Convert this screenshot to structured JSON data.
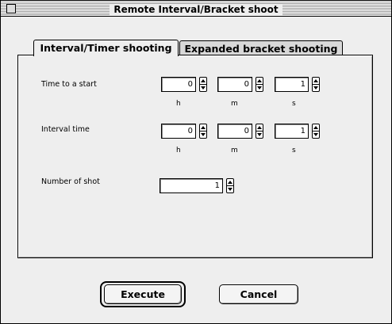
{
  "window": {
    "title": "Remote Interval/Bracket shoot"
  },
  "tabs": [
    {
      "label": "Interval/Timer shooting",
      "active": true
    },
    {
      "label": "Expanded bracket shooting",
      "active": false
    }
  ],
  "fields": {
    "time_to_start": {
      "label": "Time to a start",
      "hours": "0",
      "minutes": "0",
      "seconds": "1"
    },
    "interval_time": {
      "label": "Interval time",
      "hours": "0",
      "minutes": "0",
      "seconds": "1"
    },
    "number_of_shot": {
      "label": "Number of shot",
      "value": "1"
    }
  },
  "units": {
    "h": "h",
    "m": "m",
    "s": "s"
  },
  "buttons": {
    "execute": "Execute",
    "cancel": "Cancel"
  },
  "icons": {
    "stepper_up": "arrow-up-icon",
    "stepper_down": "arrow-down-icon"
  },
  "colors": {
    "window_bg": "#eeeeee",
    "inactive_tab": "#d8d8d8",
    "border": "#000000"
  }
}
